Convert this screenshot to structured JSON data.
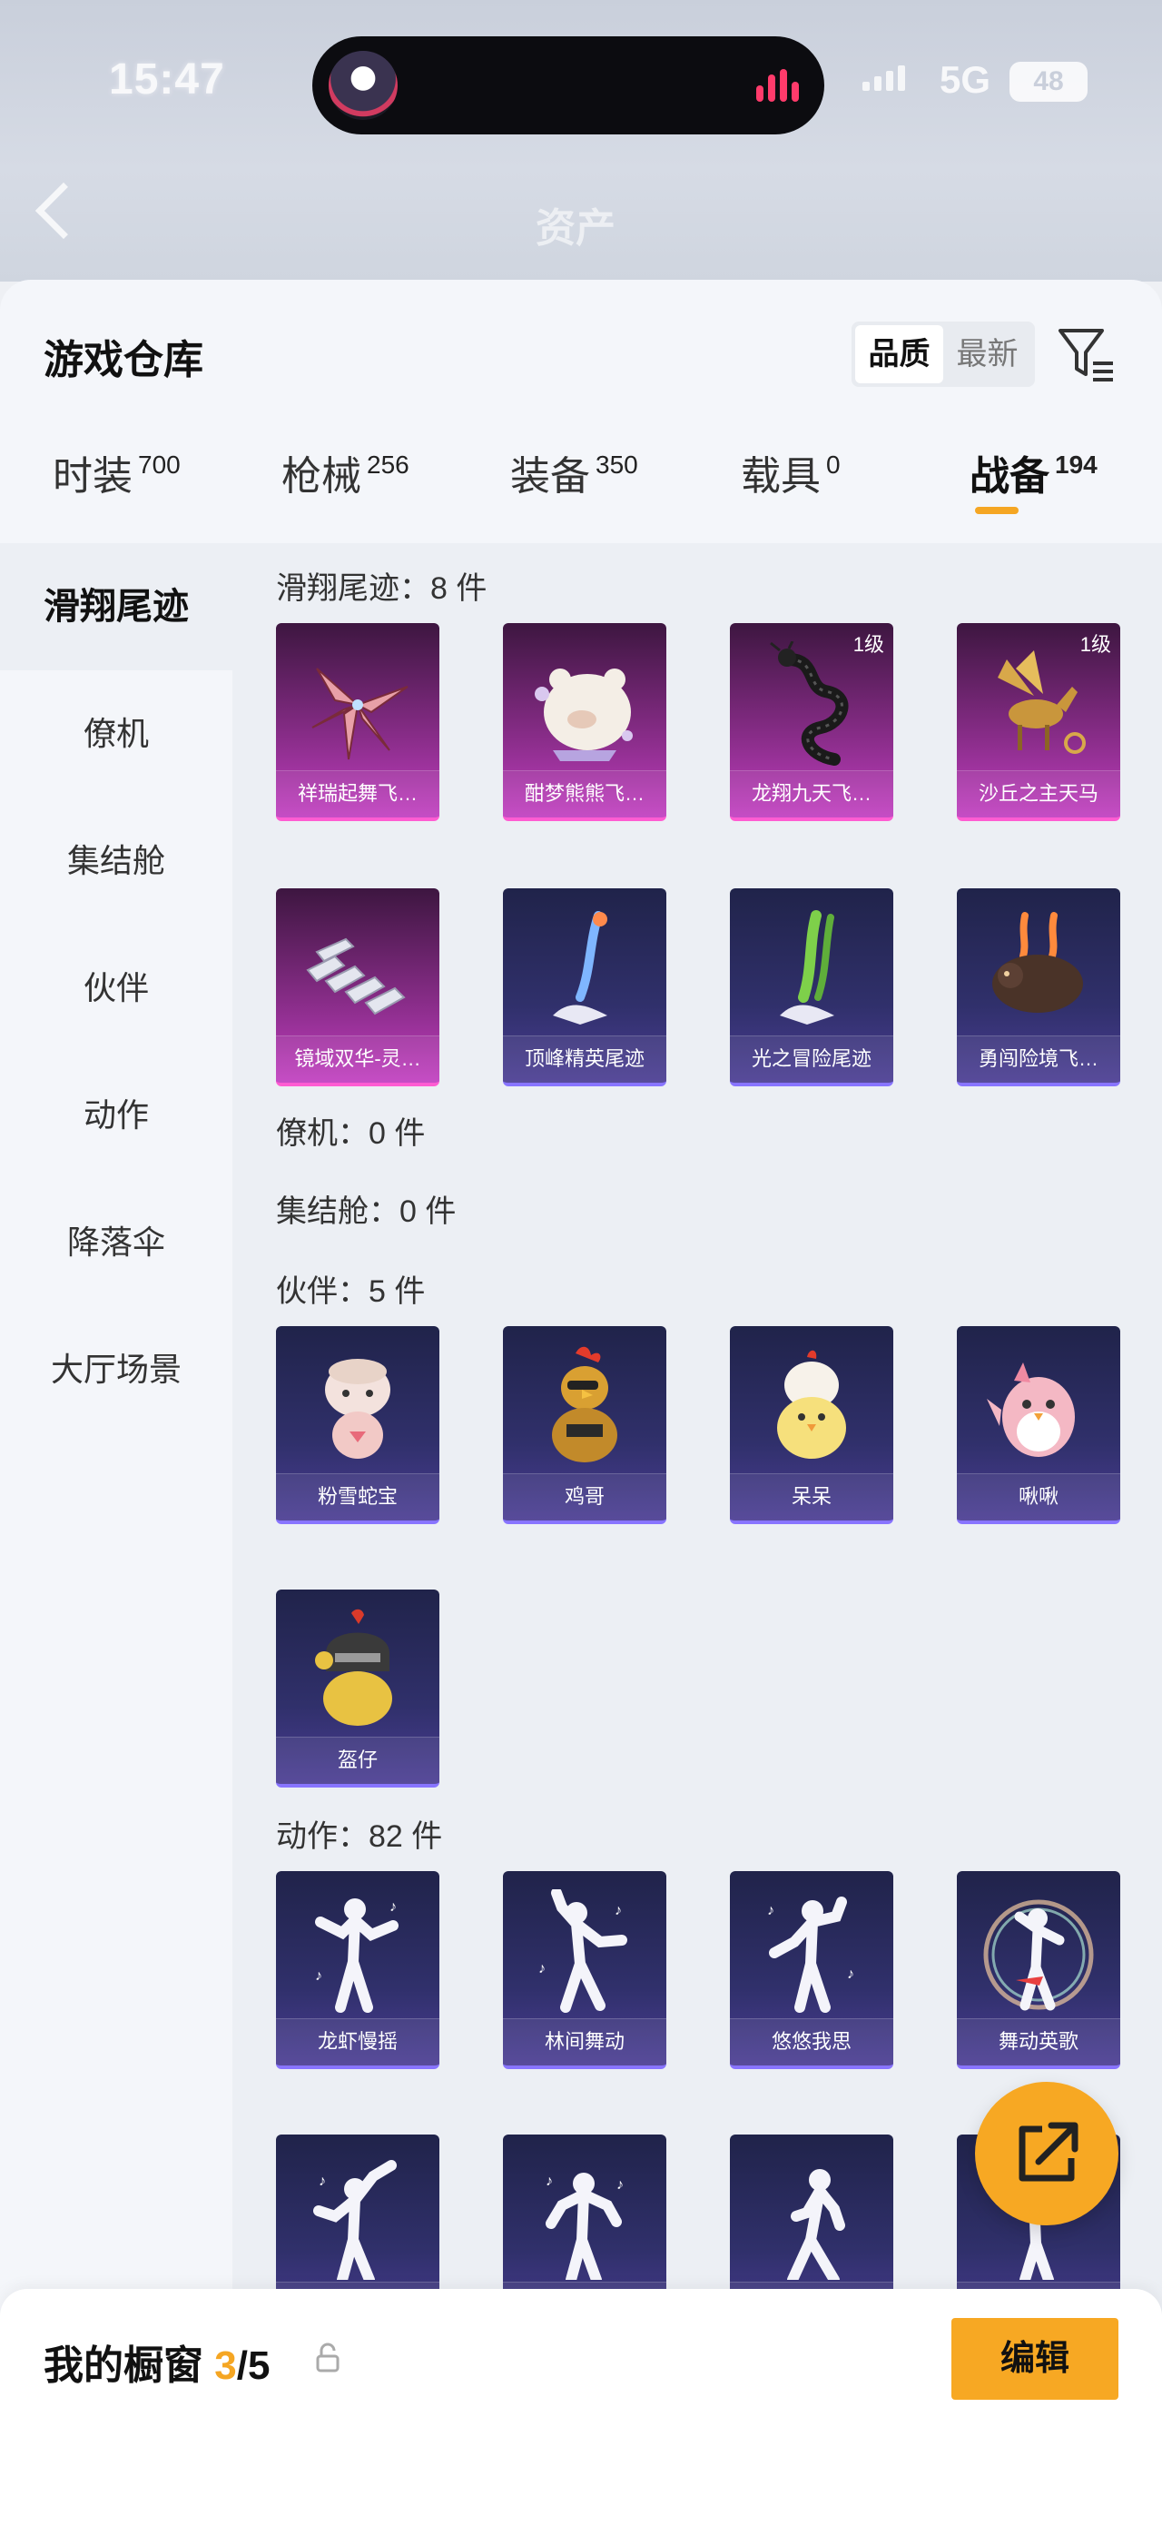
{
  "status": {
    "time": "15:47",
    "network": "5G",
    "battery": "48"
  },
  "background_header": {
    "title": "资产"
  },
  "sheet": {
    "title": "游戏仓库",
    "sort": {
      "options": [
        "品质",
        "最新"
      ],
      "selected": "品质"
    },
    "filter_icon": "filter-icon"
  },
  "tabs": [
    {
      "label": "时装",
      "count": "700"
    },
    {
      "label": "枪械",
      "count": "256"
    },
    {
      "label": "装备",
      "count": "350"
    },
    {
      "label": "载具",
      "count": "0"
    },
    {
      "label": "战备",
      "count": "194",
      "active": true
    }
  ],
  "sidebar": [
    {
      "label": "滑翔尾迹",
      "active": true
    },
    {
      "label": "僚机"
    },
    {
      "label": "集结舱"
    },
    {
      "label": "伙伴"
    },
    {
      "label": "动作"
    },
    {
      "label": "降落伞"
    },
    {
      "label": "大厅场景"
    }
  ],
  "sections": {
    "glide": {
      "header": "滑翔尾迹：8 件",
      "items": [
        {
          "name": "祥瑞起舞飞…",
          "level": "",
          "style": "pink",
          "icon": "pinwheel-icon"
        },
        {
          "name": "酣梦熊熊飞…",
          "level": "",
          "style": "pink",
          "icon": "sleeping-bear-icon"
        },
        {
          "name": "龙翔九天飞…",
          "level": "1级",
          "style": "pink",
          "icon": "dragon-icon"
        },
        {
          "name": "沙丘之主天马",
          "level": "1级",
          "style": "pink",
          "icon": "pegasus-icon"
        },
        {
          "name": "镜域双华-灵…",
          "level": "",
          "style": "pink",
          "icon": "crystal-shards-icon"
        },
        {
          "name": "顶峰精英尾迹",
          "level": "",
          "style": "blue",
          "icon": "trail-blue-icon"
        },
        {
          "name": "光之冒险尾迹",
          "level": "",
          "style": "blue",
          "icon": "trail-green-icon"
        },
        {
          "name": "勇闯险境飞…",
          "level": "",
          "style": "blue",
          "icon": "beast-icon"
        }
      ]
    },
    "wingman": {
      "header": "僚机：0 件"
    },
    "capsule": {
      "header": "集结舱：0 件"
    },
    "partner": {
      "header": "伙伴：5 件",
      "items": [
        {
          "name": "粉雪蛇宝",
          "style": "blue",
          "icon": "snow-snake-icon"
        },
        {
          "name": "鸡哥",
          "style": "blue",
          "icon": "rooster-icon"
        },
        {
          "name": "呆呆",
          "style": "blue",
          "icon": "chick-icon"
        },
        {
          "name": "啾啾",
          "style": "blue",
          "icon": "pink-bird-icon"
        },
        {
          "name": "盔仔",
          "style": "blue",
          "icon": "helmet-chick-icon"
        }
      ]
    },
    "action": {
      "header": "动作：82 件",
      "items": [
        {
          "name": "龙虾慢摇",
          "style": "blue",
          "icon": "dance-pose-icon"
        },
        {
          "name": "林间舞动",
          "style": "blue",
          "icon": "dance-pose-icon"
        },
        {
          "name": "悠悠我思",
          "style": "blue",
          "icon": "dance-pose-icon"
        },
        {
          "name": "舞动英歌",
          "style": "blue",
          "icon": "dance-pose-icon"
        },
        {
          "name": "",
          "style": "blue",
          "icon": "dance-pose-icon"
        },
        {
          "name": "",
          "style": "blue",
          "icon": "dance-pose-icon"
        },
        {
          "name": "",
          "style": "blue",
          "icon": "dance-pose-icon"
        },
        {
          "name": "",
          "style": "blue",
          "icon": "dance-pose-icon"
        }
      ]
    }
  },
  "share_icon": "share-icon",
  "bottom_bar": {
    "label": "我的橱窗",
    "count": "3",
    "total": "/5",
    "lock_icon": "lock-icon",
    "edit_label": "编辑"
  }
}
